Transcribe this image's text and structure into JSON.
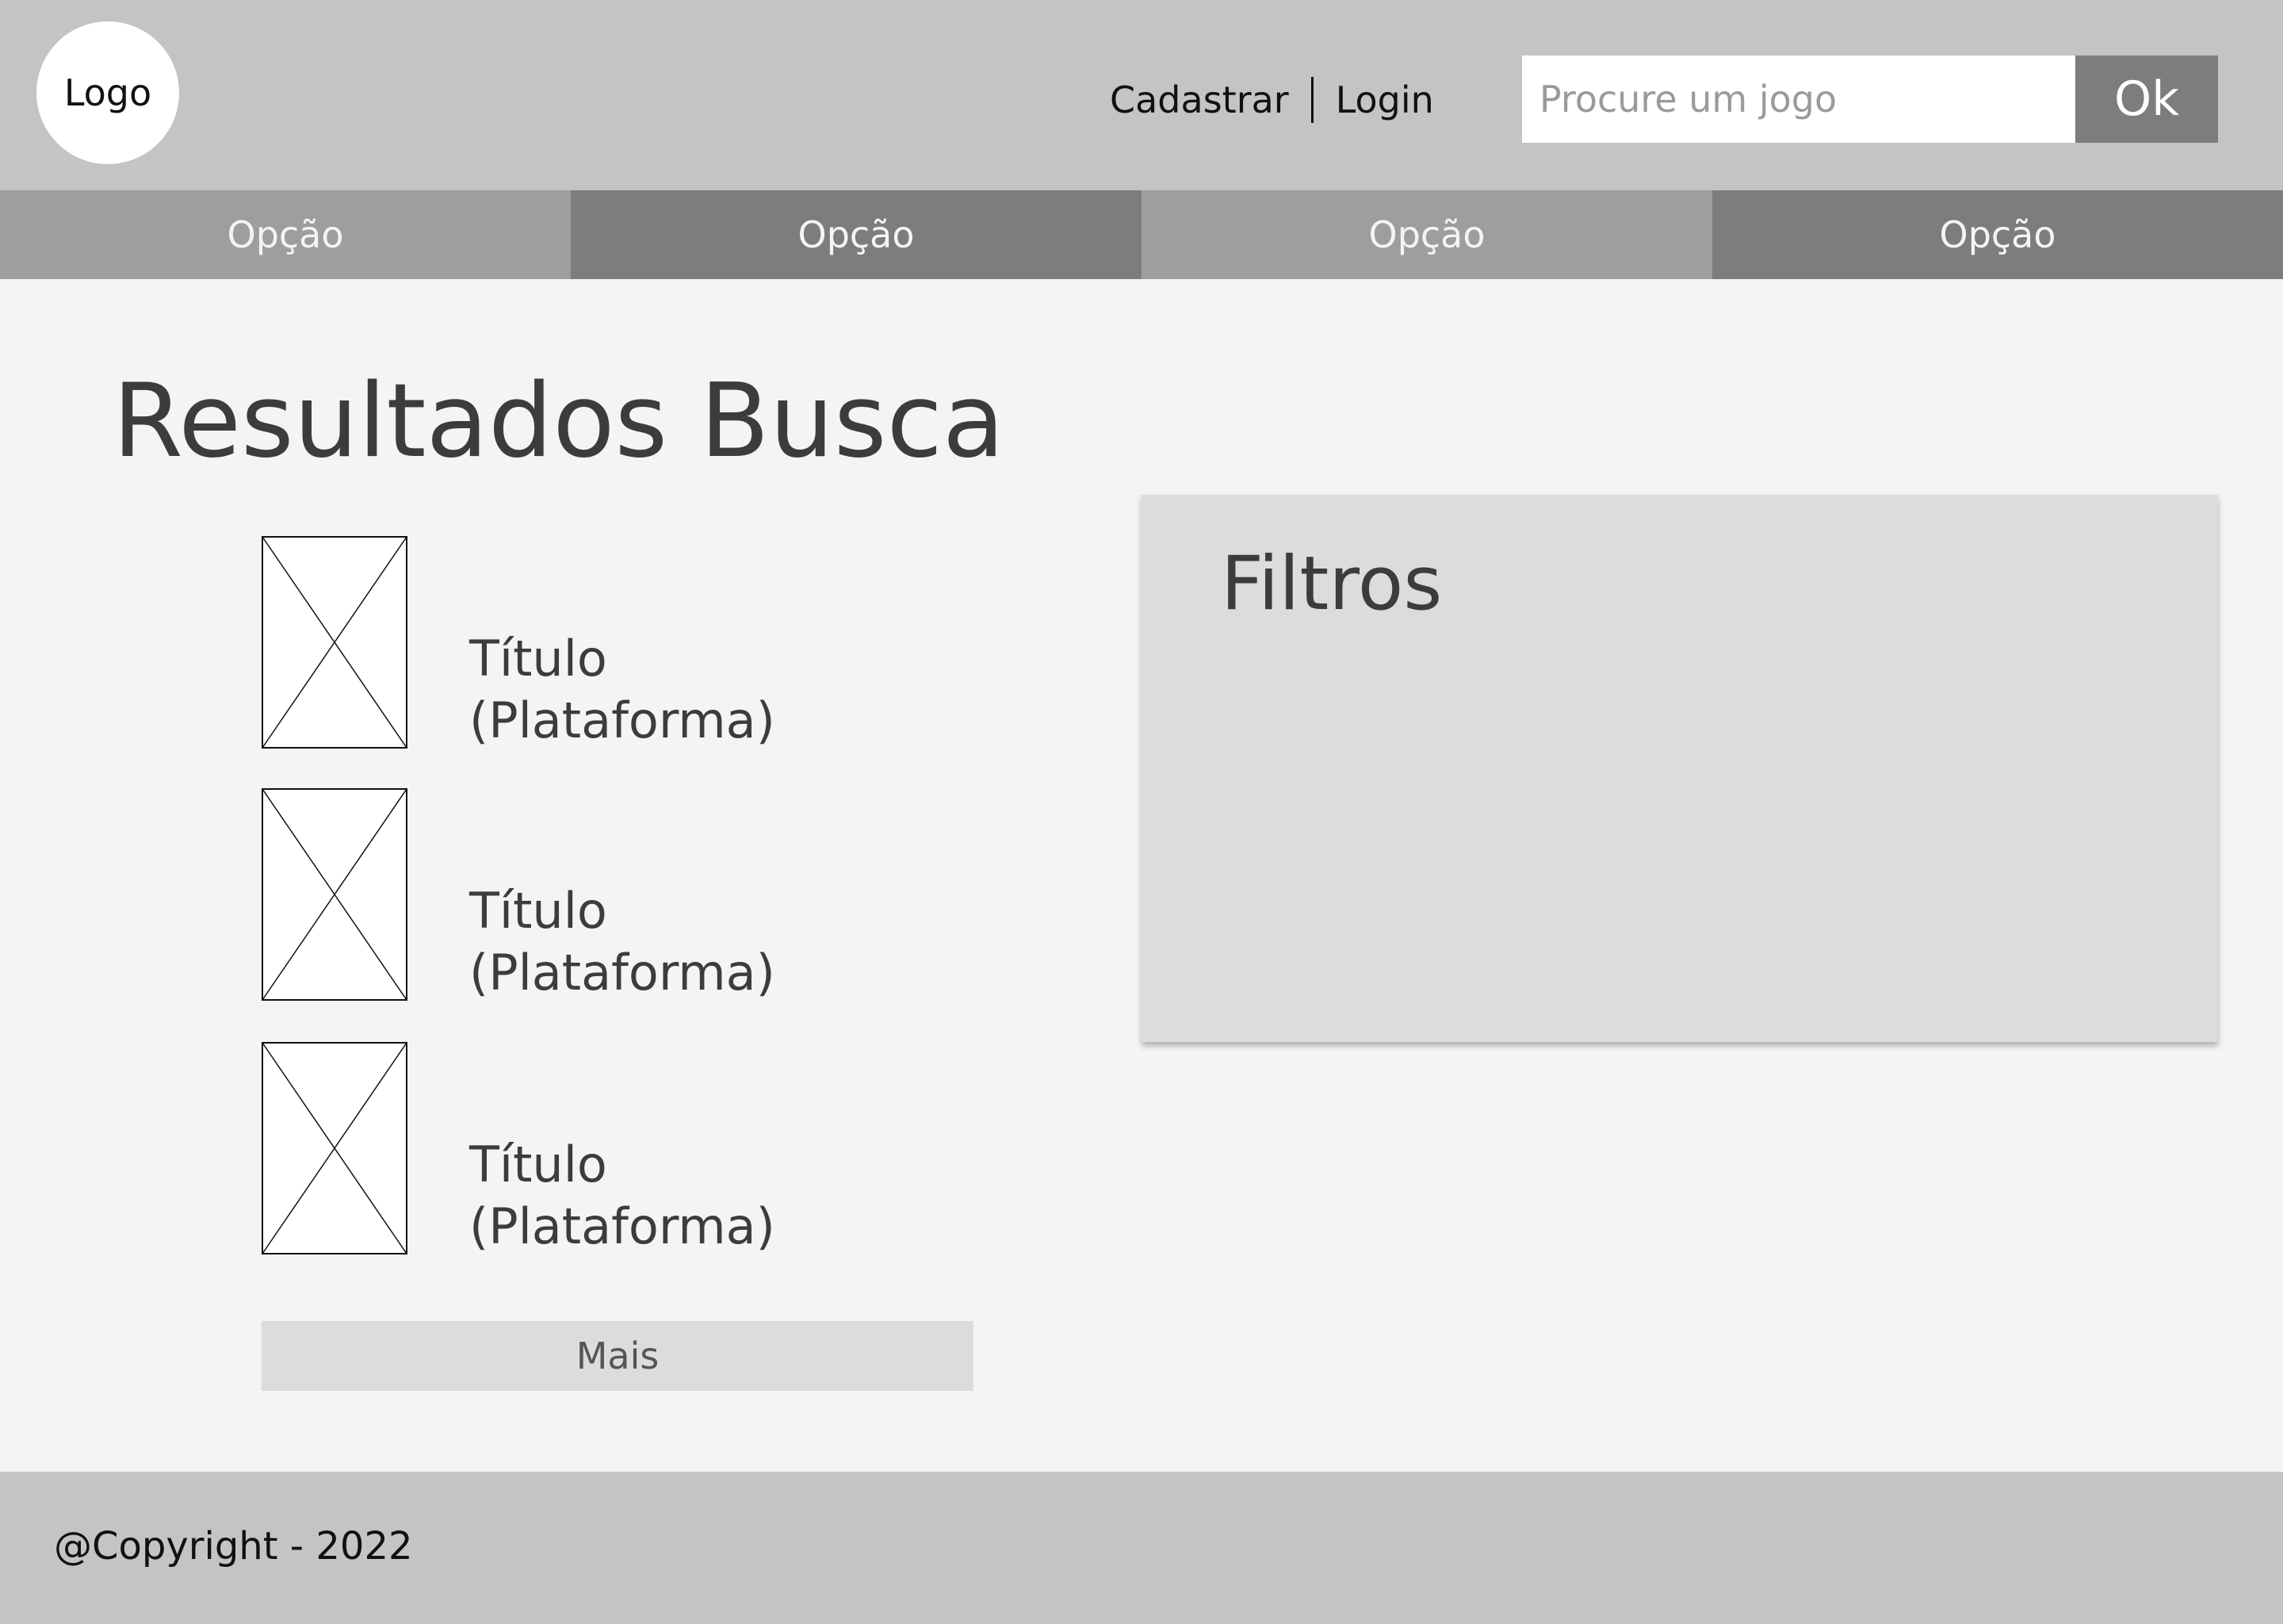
{
  "header": {
    "logo_text": "Logo",
    "register_label": "Cadastrar",
    "login_label": "Login",
    "search": {
      "placeholder": "Procure um jogo",
      "value": "",
      "button_label": "Ok"
    }
  },
  "nav": {
    "items": [
      {
        "label": "Opção"
      },
      {
        "label": "Opção"
      },
      {
        "label": "Opção"
      },
      {
        "label": "Opção"
      }
    ]
  },
  "main": {
    "title": "Resultados Busca",
    "results": [
      {
        "title": "Título",
        "platform": "(Plataforma)",
        "thumbnail_icon": "image-placeholder-icon"
      },
      {
        "title": "Título",
        "platform": "(Plataforma)",
        "thumbnail_icon": "image-placeholder-icon"
      },
      {
        "title": "Título",
        "platform": "(Plataforma)",
        "thumbnail_icon": "image-placeholder-icon"
      }
    ],
    "more_label": "Mais"
  },
  "filters": {
    "title": "Filtros"
  },
  "footer": {
    "copyright": "@Copyright - 2022"
  },
  "colors": {
    "header_bg": "#c4c4c4",
    "nav_light": "#9e9e9e",
    "nav_dark": "#7d7d7d",
    "page_bg": "#f4f4f4",
    "panel_bg": "#dcdcdc",
    "text_dark": "#3c3c3c"
  }
}
